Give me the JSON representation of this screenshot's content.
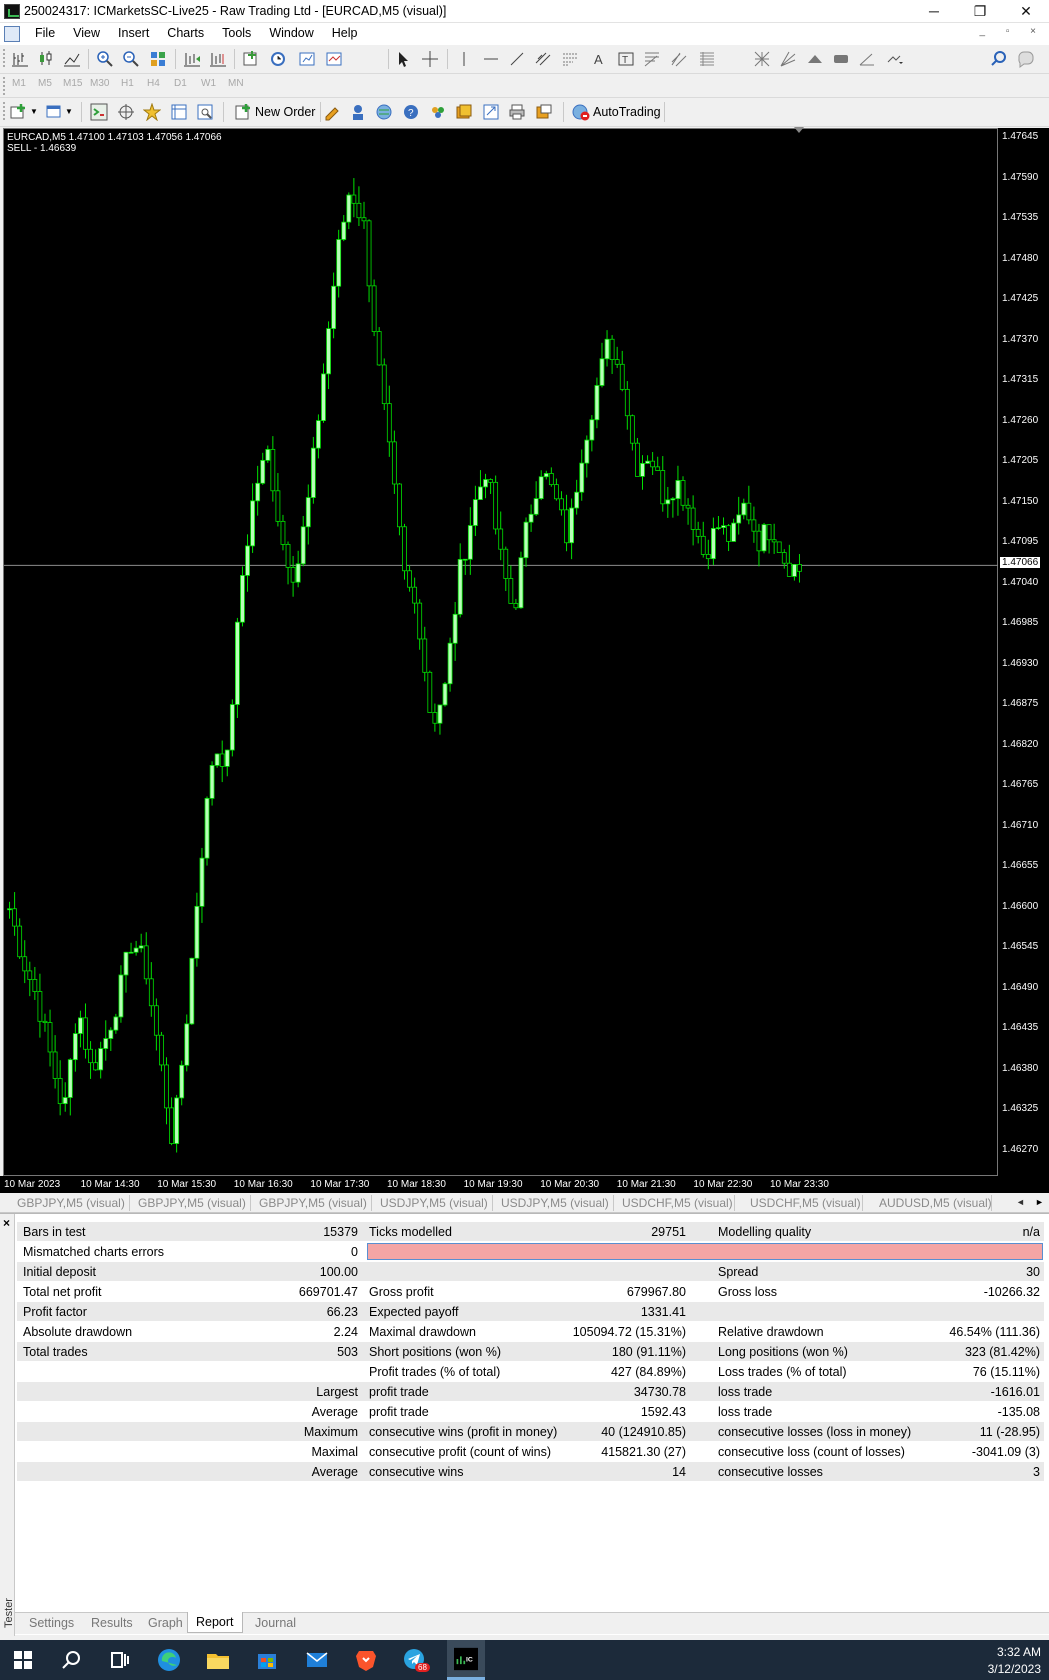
{
  "window": {
    "title": "250024317: ICMarketsSC-Live25 - Raw Trading Ltd - [EURCAD,M5 (visual)]",
    "minimize": "─",
    "restore": "❐",
    "close": "✕"
  },
  "menu": [
    "File",
    "View",
    "Insert",
    "Charts",
    "Tools",
    "Window",
    "Help"
  ],
  "mdi_controls": "_ ▫ ×",
  "notifications": {
    "count": "1"
  },
  "timeframes": [
    "M1",
    "M5",
    "M15",
    "M30",
    "H1",
    "H4",
    "D1",
    "W1",
    "MN"
  ],
  "toolbar3": {
    "new_order": "New Order",
    "autotrading": "AutoTrading"
  },
  "chart": {
    "symbol_line": "EURCAD,M5  1.47100 1.47103 1.47056 1.47066",
    "order_line": "SELL - 1.46639",
    "current_price": "1.47066",
    "price_labels": [
      "1.47645",
      "1.47590",
      "1.47535",
      "1.47480",
      "1.47425",
      "1.47370",
      "1.47315",
      "1.47260",
      "1.47205",
      "1.47150",
      "1.47095",
      "1.47040",
      "1.46985",
      "1.46930",
      "1.46875",
      "1.46820",
      "1.46765",
      "1.46710",
      "1.46655",
      "1.46600",
      "1.46545",
      "1.46490",
      "1.46435",
      "1.46380",
      "1.46325",
      "1.46270"
    ],
    "time_labels": [
      "10 Mar 2023",
      "10 Mar 14:30",
      "10 Mar 15:30",
      "10 Mar 16:30",
      "10 Mar 17:30",
      "10 Mar 18:30",
      "10 Mar 19:30",
      "10 Mar 20:30",
      "10 Mar 21:30",
      "10 Mar 22:30",
      "10 Mar 23:30"
    ],
    "colors": {
      "background": "#000000",
      "bull": "#00e000",
      "bear": "#00e000",
      "bull_body": "#b8ffb8",
      "price_line": "#8c8c8c"
    }
  },
  "chart_data": {
    "type": "candlestick",
    "symbol": "EURCAD",
    "timeframe": "M5",
    "ylim": [
      1.4624,
      1.477
    ],
    "close_sample": [
      1.466,
      1.4653,
      1.4648,
      1.464,
      1.4632,
      1.4647,
      1.4638,
      1.4642,
      1.4648,
      1.4656,
      1.4652,
      1.464,
      1.4628,
      1.4645,
      1.4666,
      1.4682,
      1.468,
      1.4704,
      1.4717,
      1.4722,
      1.471,
      1.4705,
      1.4716,
      1.4732,
      1.4748,
      1.4758,
      1.4753,
      1.4735,
      1.472,
      1.4705,
      1.47,
      1.4685,
      1.469,
      1.4705,
      1.4714,
      1.472,
      1.4708,
      1.47,
      1.4712,
      1.472,
      1.4716,
      1.471,
      1.4722,
      1.473,
      1.4737,
      1.4732,
      1.472,
      1.4722,
      1.4716,
      1.4718,
      1.4714,
      1.4708,
      1.4712,
      1.471,
      1.4715,
      1.471,
      1.4712,
      1.4707,
      1.4706
    ]
  },
  "chart_tabs": [
    "GBPJPY,M5 (visual)",
    "GBPJPY,M5 (visual)",
    "GBPJPY,M5 (visual)",
    "USDJPY,M5 (visual)",
    "USDJPY,M5 (visual)",
    "USDCHF,M5 (visual)",
    "USDCHF,M5 (visual)",
    "AUDUSD,M5 (visual)"
  ],
  "report": {
    "rows": [
      {
        "c1": "Bars in test",
        "c2": "15379",
        "c3": "Ticks modelled",
        "c4": "29751",
        "c5": "Modelling quality",
        "c6": "n/a"
      },
      {
        "c1": "Mismatched charts errors",
        "c2": "0",
        "c3": "",
        "c4": "",
        "c5": "",
        "c6": ""
      },
      {
        "c1": "Initial deposit",
        "c2": "100.00",
        "c3": "",
        "c4": "",
        "c5": "Spread",
        "c6": "30"
      },
      {
        "c1": "Total net profit",
        "c2": "669701.47",
        "c3": "Gross profit",
        "c4": "679967.80",
        "c5": "Gross loss",
        "c6": "-10266.32"
      },
      {
        "c1": "Profit factor",
        "c2": "66.23",
        "c3": "Expected payoff",
        "c4": "1331.41",
        "c5": "",
        "c6": ""
      },
      {
        "c1": "Absolute drawdown",
        "c2": "2.24",
        "c3": "Maximal drawdown",
        "c4": "105094.72 (15.31%)",
        "c5": "Relative drawdown",
        "c6": "46.54% (111.36)"
      },
      {
        "c1": "Total trades",
        "c2": "503",
        "c3": "Short positions (won %)",
        "c4": "180 (91.11%)",
        "c5": "Long positions (won %)",
        "c6": "323 (81.42%)"
      },
      {
        "c1": "",
        "c2": "",
        "c3": "Profit trades (% of total)",
        "c4": "427 (84.89%)",
        "c5": "Loss trades (% of total)",
        "c6": "76 (15.11%)"
      },
      {
        "c1": "",
        "c2": "Largest",
        "c3": "profit trade",
        "c4": "34730.78",
        "c5": "loss trade",
        "c6": "-1616.01"
      },
      {
        "c1": "",
        "c2": "Average",
        "c3": "profit trade",
        "c4": "1592.43",
        "c5": "loss trade",
        "c6": "-135.08"
      },
      {
        "c1": "",
        "c2": "Maximum",
        "c3": "consecutive wins (profit in money)",
        "c4": "40 (124910.85)",
        "c5": "consecutive losses (loss in money)",
        "c6": "11 (-28.95)"
      },
      {
        "c1": "",
        "c2": "Maximal",
        "c3": "consecutive profit (count of wins)",
        "c4": "415821.30 (27)",
        "c5": "consecutive loss (count of losses)",
        "c6": "-3041.09 (3)"
      },
      {
        "c1": "",
        "c2": "Average",
        "c3": "consecutive wins",
        "c4": "14",
        "c5": "consecutive losses",
        "c6": "3"
      }
    ]
  },
  "tester": {
    "close": "×",
    "label": "Tester",
    "tabs": [
      "Settings",
      "Results",
      "Graph",
      "Report",
      "Journal"
    ],
    "active_tab": "Report"
  },
  "taskbar": {
    "time": "3:32 AM",
    "date": "3/12/2023",
    "telegram_badge": "68"
  }
}
